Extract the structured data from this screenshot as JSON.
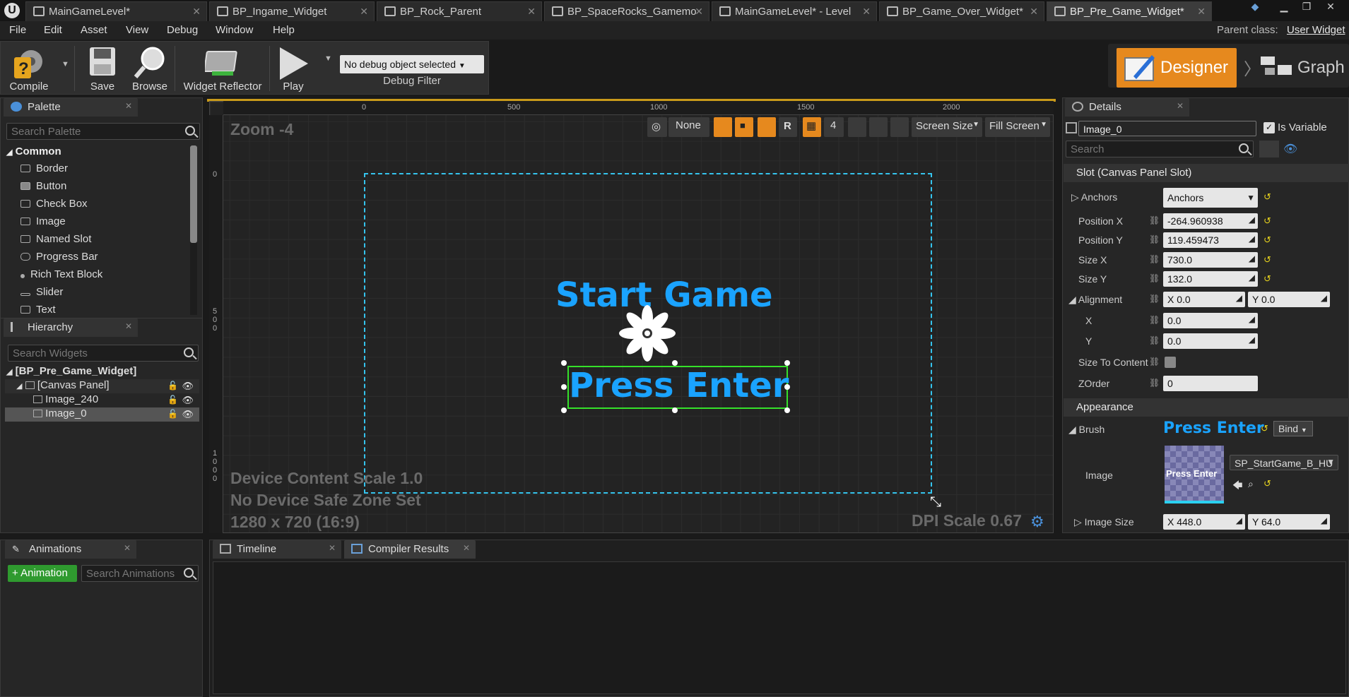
{
  "tabs": [
    {
      "label": "MainGameLevel*",
      "active": false
    },
    {
      "label": "BP_Ingame_Widget",
      "active": false
    },
    {
      "label": "BP_Rock_Parent",
      "active": false
    },
    {
      "label": "BP_SpaceRocks_Gamemo",
      "active": false
    },
    {
      "label": "MainGameLevel* - Level",
      "active": false
    },
    {
      "label": "BP_Game_Over_Widget*",
      "active": false
    },
    {
      "label": "BP_Pre_Game_Widget*",
      "active": true
    }
  ],
  "menu": [
    "File",
    "Edit",
    "Asset",
    "View",
    "Debug",
    "Window",
    "Help"
  ],
  "parent_class": {
    "label": "Parent class:",
    "value": "User Widget"
  },
  "toolbar": {
    "compile": "Compile",
    "save": "Save",
    "browse": "Browse",
    "widget_reflector": "Widget Reflector",
    "play": "Play",
    "debug_object": "No debug object selected",
    "debug_filter": "Debug Filter"
  },
  "mode": {
    "designer": "Designer",
    "graph": "Graph"
  },
  "palette": {
    "title": "Palette",
    "search_placeholder": "Search Palette",
    "category": "Common",
    "items": [
      "Border",
      "Button",
      "Check Box",
      "Image",
      "Named Slot",
      "Progress Bar",
      "Rich Text Block",
      "Slider",
      "Text"
    ]
  },
  "hierarchy": {
    "title": "Hierarchy",
    "search_placeholder": "Search Widgets",
    "root": "[BP_Pre_Game_Widget]",
    "items": [
      "[Canvas Panel]",
      "Image_240",
      "Image_0"
    ]
  },
  "viewport": {
    "zoom": "Zoom -4",
    "ruler_top": [
      "0",
      "500",
      "1000",
      "1500",
      "2000"
    ],
    "ruler_left": [
      "0",
      "5",
      "0",
      "0",
      "1",
      "0",
      "0",
      "0"
    ],
    "device_scale": "Device Content Scale 1.0",
    "safe_zone": "No Device Safe Zone Set",
    "resolution": "1280 x 720 (16:9)",
    "dpi": "DPI Scale 0.67",
    "start_game": "Start Game",
    "press_enter": "Press Enter",
    "toolbar": {
      "none": "None",
      "r": "R",
      "grid": "4",
      "screen_size": "Screen Size",
      "fill_screen": "Fill Screen"
    }
  },
  "details": {
    "title": "Details",
    "name": "Image_0",
    "is_variable": "Is Variable",
    "search_placeholder": "Search",
    "slot_section": "Slot (Canvas Panel Slot)",
    "anchors_label": "Anchors",
    "anchors_value": "Anchors",
    "position_x_label": "Position X",
    "position_x": "-264.960938",
    "position_y_label": "Position Y",
    "position_y": "119.459473",
    "size_x_label": "Size X",
    "size_x": "730.0",
    "size_y_label": "Size Y",
    "size_y": "132.0",
    "alignment_label": "Alignment",
    "alignment_x": "X  0.0",
    "alignment_y": "Y  0.0",
    "x_label": "X",
    "x_value": "0.0",
    "y_label": "Y",
    "y_value": "0.0",
    "size_to_content": "Size To Content",
    "zorder_label": "ZOrder",
    "zorder": "0",
    "appearance_section": "Appearance",
    "brush_label": "Brush",
    "brush_preview": "Press Enter",
    "bind": "Bind",
    "image_label": "Image",
    "image_asset": "SP_StartGame_B_HU",
    "thumb_text": "Press Enter",
    "image_size_label": "Image Size",
    "image_size_x": "X  448.0",
    "image_size_y": "Y  64.0"
  },
  "animations": {
    "title": "Animations",
    "add": "+ Animation",
    "search_placeholder": "Search Animations"
  },
  "bottom_tabs": [
    "Timeline",
    "Compiler Results"
  ],
  "colors": {
    "accent": "#e6891e",
    "widget_text": "#1aa3ff",
    "selection": "#35e02a",
    "canvas_outline": "#35c4ee"
  }
}
